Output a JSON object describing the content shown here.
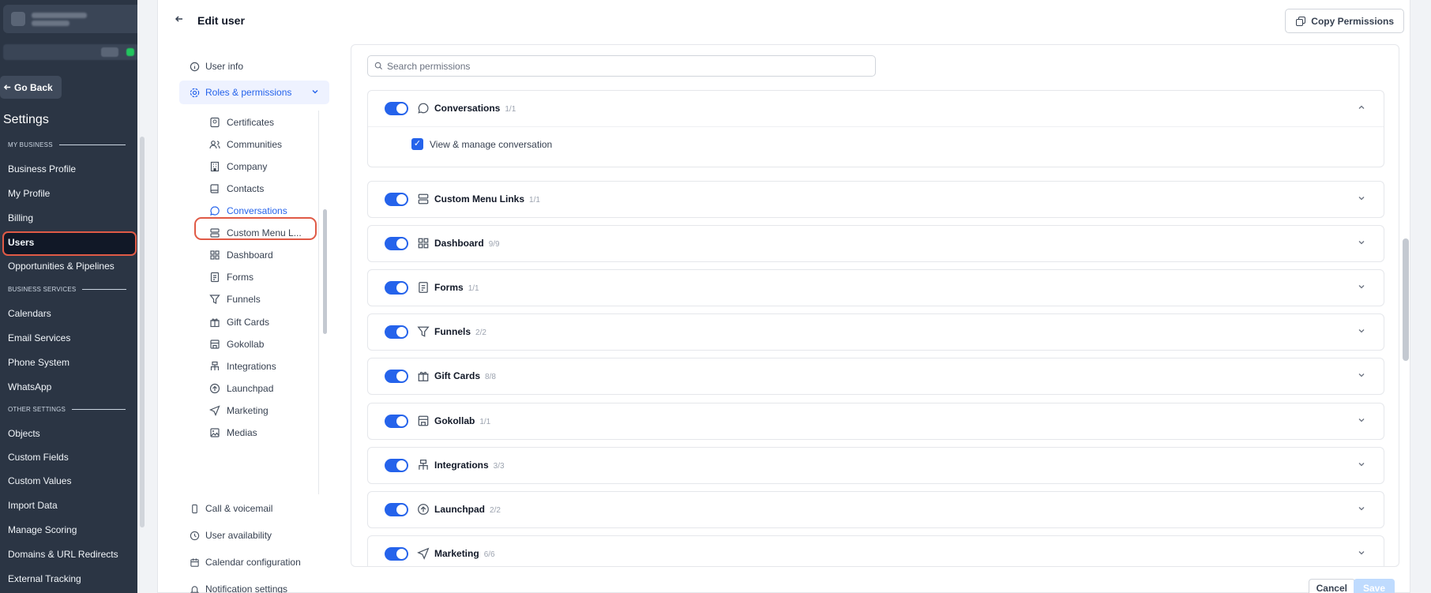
{
  "sidebar": {
    "go_back": "Go Back",
    "title": "Settings",
    "sections": [
      {
        "label": "MY BUSINESS",
        "items": [
          "Business Profile",
          "My Profile",
          "Billing",
          "Users",
          "Opportunities & Pipelines"
        ]
      },
      {
        "label": "BUSINESS SERVICES",
        "items": [
          "Calendars",
          "Email Services",
          "Phone System",
          "WhatsApp"
        ]
      },
      {
        "label": "OTHER SETTINGS",
        "items": [
          "Objects",
          "Custom Fields",
          "Custom Values",
          "Import Data",
          "Manage Scoring",
          "Domains & URL Redirects",
          "External Tracking"
        ]
      }
    ],
    "active_item": "Users"
  },
  "header": {
    "title": "Edit user",
    "copy_permissions": "Copy Permissions"
  },
  "settings_nav": {
    "user_info": "User info",
    "roles": "Roles & permissions",
    "sub_items": [
      "Certificates",
      "Communities",
      "Company",
      "Contacts",
      "Conversations",
      "Custom Menu L...",
      "Dashboard",
      "Forms",
      "Funnels",
      "Gift Cards",
      "Gokollab",
      "Integrations",
      "Launchpad",
      "Marketing",
      "Medias"
    ],
    "active_sub_item": "Conversations",
    "bottom_items": [
      "Call & voicemail",
      "User availability",
      "Calendar configuration",
      "Notification settings"
    ]
  },
  "permissions": {
    "search_placeholder": "Search permissions",
    "groups": [
      {
        "name": "Conversations",
        "count": "1/1",
        "icon": "chat-icon",
        "expanded": true,
        "items": [
          {
            "label": "View & manage conversation",
            "checked": true
          }
        ]
      },
      {
        "name": "Custom Menu Links",
        "count": "1/1",
        "icon": "menu-links-icon",
        "expanded": false
      },
      {
        "name": "Dashboard",
        "count": "9/9",
        "icon": "grid-icon",
        "expanded": false
      },
      {
        "name": "Forms",
        "count": "1/1",
        "icon": "form-icon",
        "expanded": false
      },
      {
        "name": "Funnels",
        "count": "2/2",
        "icon": "funnel-icon",
        "expanded": false
      },
      {
        "name": "Gift Cards",
        "count": "8/8",
        "icon": "gift-icon",
        "expanded": false
      },
      {
        "name": "Gokollab",
        "count": "1/1",
        "icon": "store-icon",
        "expanded": false
      },
      {
        "name": "Integrations",
        "count": "3/3",
        "icon": "integrations-icon",
        "expanded": false
      },
      {
        "name": "Launchpad",
        "count": "2/2",
        "icon": "launchpad-icon",
        "expanded": false
      },
      {
        "name": "Marketing",
        "count": "6/6",
        "icon": "send-icon",
        "expanded": false
      }
    ]
  },
  "footer": {
    "cancel": "Cancel",
    "save": "Save"
  },
  "colors": {
    "sidebar_bg": "#2b3544",
    "accent": "#2563eb",
    "highlight_outline": "#e05a46"
  }
}
